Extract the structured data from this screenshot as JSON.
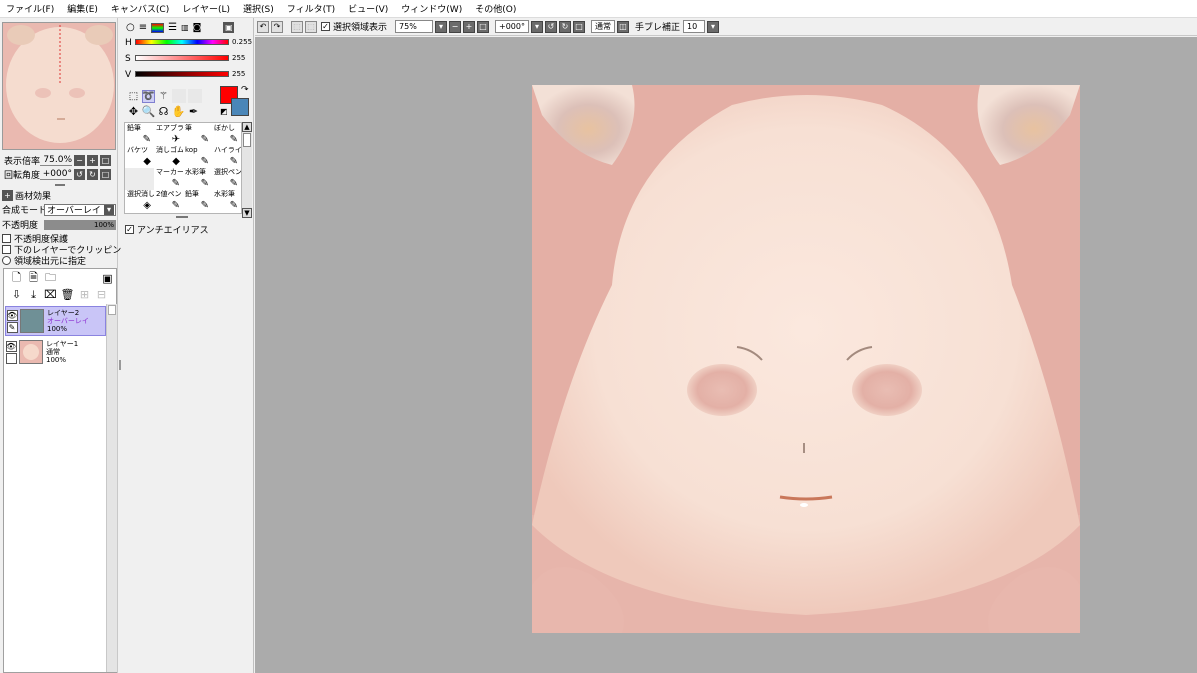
{
  "menu": [
    "ファイル(F)",
    "編集(E)",
    "キャンバス(C)",
    "レイヤー(L)",
    "選択(S)",
    "フィルタ(T)",
    "ビュー(V)",
    "ウィンドウ(W)",
    "その他(O)"
  ],
  "navigator": {
    "zoom_label": "表示倍率",
    "zoom_value": "75.0%",
    "rotation_label": "回転角度",
    "rotation_value": "+000°"
  },
  "layer_props": {
    "texture_effect": "画材効果",
    "blend_mode_label": "合成モード",
    "blend_mode_value": "オーバーレイ",
    "opacity_label": "不透明度",
    "opacity_value": "100%",
    "protect_opacity": "不透明度保護",
    "clip_to_lower": "下のレイヤーでクリッピング",
    "selection_source": "領域検出元に指定"
  },
  "layers": [
    {
      "name": "レイヤー2",
      "mode": "オーバーレイ",
      "opacity": "100%",
      "thumb_color": "#6f9096",
      "selected": true
    },
    {
      "name": "レイヤー1",
      "mode": "通常",
      "opacity": "100%",
      "thumb_color": "#eab9b0",
      "selected": false
    }
  ],
  "color": {
    "h_label": "H",
    "h_value": "0.255",
    "s_label": "S",
    "s_value": "255",
    "v_label": "V",
    "v_value": "255",
    "foreground": "#ff0000",
    "background": "#4a86b8"
  },
  "tools": [
    {
      "label": "鉛筆",
      "icon": "✎"
    },
    {
      "label": "エアブラシ",
      "icon": "✈"
    },
    {
      "label": "筆",
      "icon": "✎"
    },
    {
      "label": "ぼかし",
      "icon": "✎"
    },
    {
      "label": "バケツ",
      "icon": "◆"
    },
    {
      "label": "消しゴム",
      "icon": "◆"
    },
    {
      "label": "kop",
      "icon": "✎"
    },
    {
      "label": "ハイライト",
      "icon": "✎"
    },
    {
      "label": "",
      "icon": ""
    },
    {
      "label": "マーカー",
      "icon": "✎"
    },
    {
      "label": "水彩筆",
      "icon": "✎"
    },
    {
      "label": "選択ペン",
      "icon": "✎"
    },
    {
      "label": "選択消し",
      "icon": "◈"
    },
    {
      "label": "2値ペン",
      "icon": "✎"
    },
    {
      "label": "鉛筆",
      "icon": "✎"
    },
    {
      "label": "水彩筆",
      "icon": "✎"
    }
  ],
  "antialias_label": "アンチエイリアス",
  "toolbar": {
    "show_selection": "選択領域表示",
    "zoom": "75%",
    "rotation": "+000°",
    "mode": "通常",
    "stabilizer_label": "手ブレ補正",
    "stabilizer_value": "10"
  }
}
